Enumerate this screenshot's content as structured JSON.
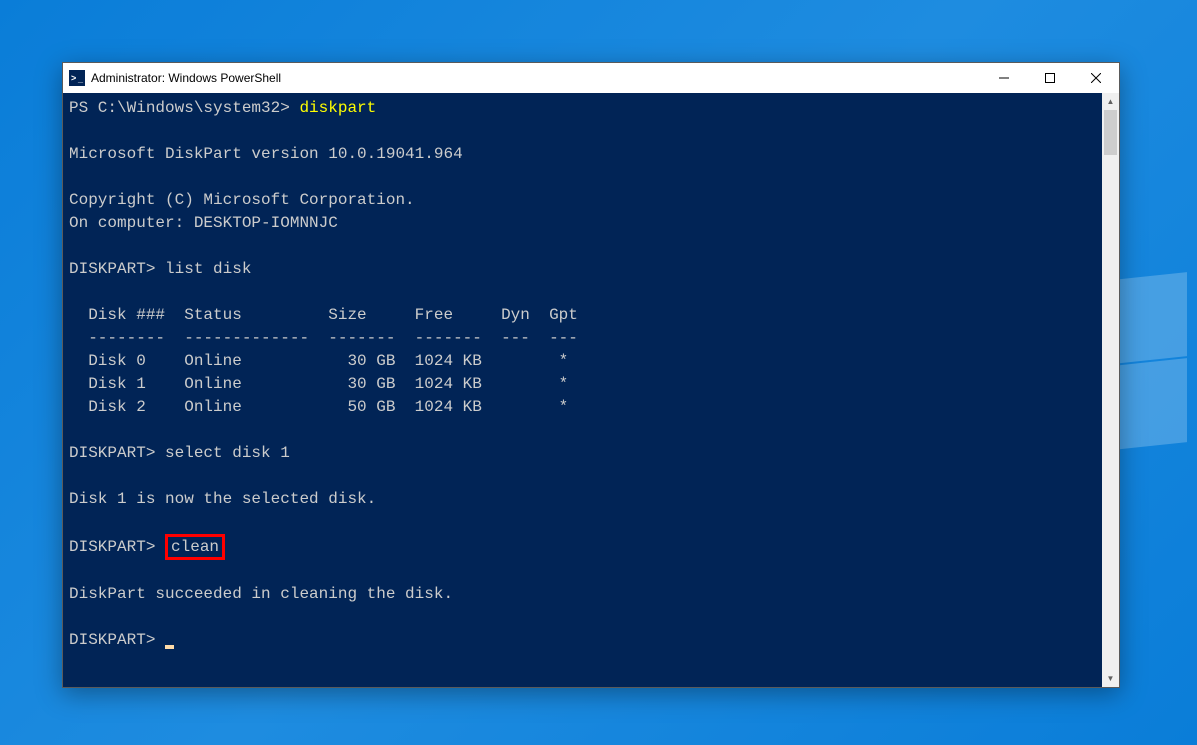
{
  "window": {
    "title": "Administrator: Windows PowerShell"
  },
  "terminal": {
    "prompt_ps": "PS C:\\Windows\\system32> ",
    "cmd_diskpart": "diskpart",
    "version_line": "Microsoft DiskPart version 10.0.19041.964",
    "copyright_line": "Copyright (C) Microsoft Corporation.",
    "computer_line": "On computer: DESKTOP-IOMNNJC",
    "prompt_dp": "DISKPART> ",
    "cmd_list_disk": "list disk",
    "table": {
      "header": "  Disk ###  Status         Size     Free     Dyn  Gpt",
      "divider": "  --------  -------------  -------  -------  ---  ---",
      "rows": [
        "  Disk 0    Online           30 GB  1024 KB        *",
        "  Disk 1    Online           30 GB  1024 KB        *",
        "  Disk 2    Online           50 GB  1024 KB        *"
      ]
    },
    "cmd_select": "select disk 1",
    "msg_selected": "Disk 1 is now the selected disk.",
    "cmd_clean": "clean",
    "msg_clean_ok": "DiskPart succeeded in cleaning the disk."
  }
}
